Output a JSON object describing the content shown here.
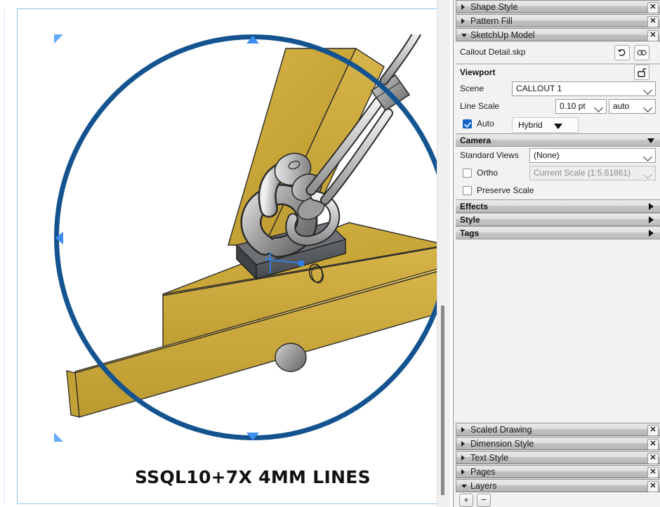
{
  "document": {
    "caption": "SSQL10+7X 4MM LINES",
    "model_description": "sketchup-3d-model-shackle-on-timber-beams"
  },
  "panel": {
    "collapsed_top": [
      {
        "label": "Shape Style",
        "state": "collapsed",
        "close": "✕"
      },
      {
        "label": "Pattern Fill",
        "state": "collapsed",
        "close": "✕"
      }
    ],
    "sketchup_model": {
      "title": "SketchUp Model",
      "close": "✕",
      "file_name": "Callout Detail.skp",
      "reload_icon": "refresh-icon",
      "link_icon": "link-icon",
      "viewport": {
        "title": "Viewport",
        "lock_icon": "unlock-icon",
        "scene_label": "Scene",
        "scene_value": "CALLOUT 1",
        "line_scale_label": "Line Scale",
        "line_scale_value": "0.10 pt",
        "line_scale_units": "auto",
        "auto_label": "Auto",
        "auto_checked": true,
        "render_mode": "Hybrid"
      },
      "camera": {
        "title": "Camera",
        "standard_views_label": "Standard Views",
        "standard_views_value": "(None)",
        "ortho_label": "Ortho",
        "ortho_checked": false,
        "scale_value": "Current Scale (1:5.61861)",
        "scale_disabled": true,
        "preserve_scale_label": "Preserve Scale",
        "preserve_scale_checked": false
      },
      "sub_sections": [
        {
          "label": "Effects",
          "state": "collapsed"
        },
        {
          "label": "Style",
          "state": "collapsed"
        },
        {
          "label": "Tags",
          "state": "collapsed"
        }
      ]
    },
    "collapsed_bottom": [
      {
        "label": "Scaled Drawing",
        "state": "collapsed",
        "close": "✕"
      },
      {
        "label": "Dimension Style",
        "state": "collapsed",
        "close": "✕"
      },
      {
        "label": "Text Style",
        "state": "collapsed",
        "close": "✕"
      },
      {
        "label": "Pages",
        "state": "collapsed",
        "close": "✕"
      }
    ],
    "layers": {
      "label": "Layers",
      "state": "expanded",
      "close": "✕",
      "add_button": "+",
      "remove_button": "−"
    }
  },
  "colors": {
    "circle_stroke": "#14538f",
    "handle_light": "#63aaf7",
    "handle_mid": "#3d8ef0",
    "wood": "#ccaa3c",
    "wood_dark": "#b8942f",
    "metal": "#9e9e9e",
    "accent_checkbox": "#1463c6",
    "panel_bg": "#f2f2f2",
    "page_border": "#8fc4f2"
  }
}
